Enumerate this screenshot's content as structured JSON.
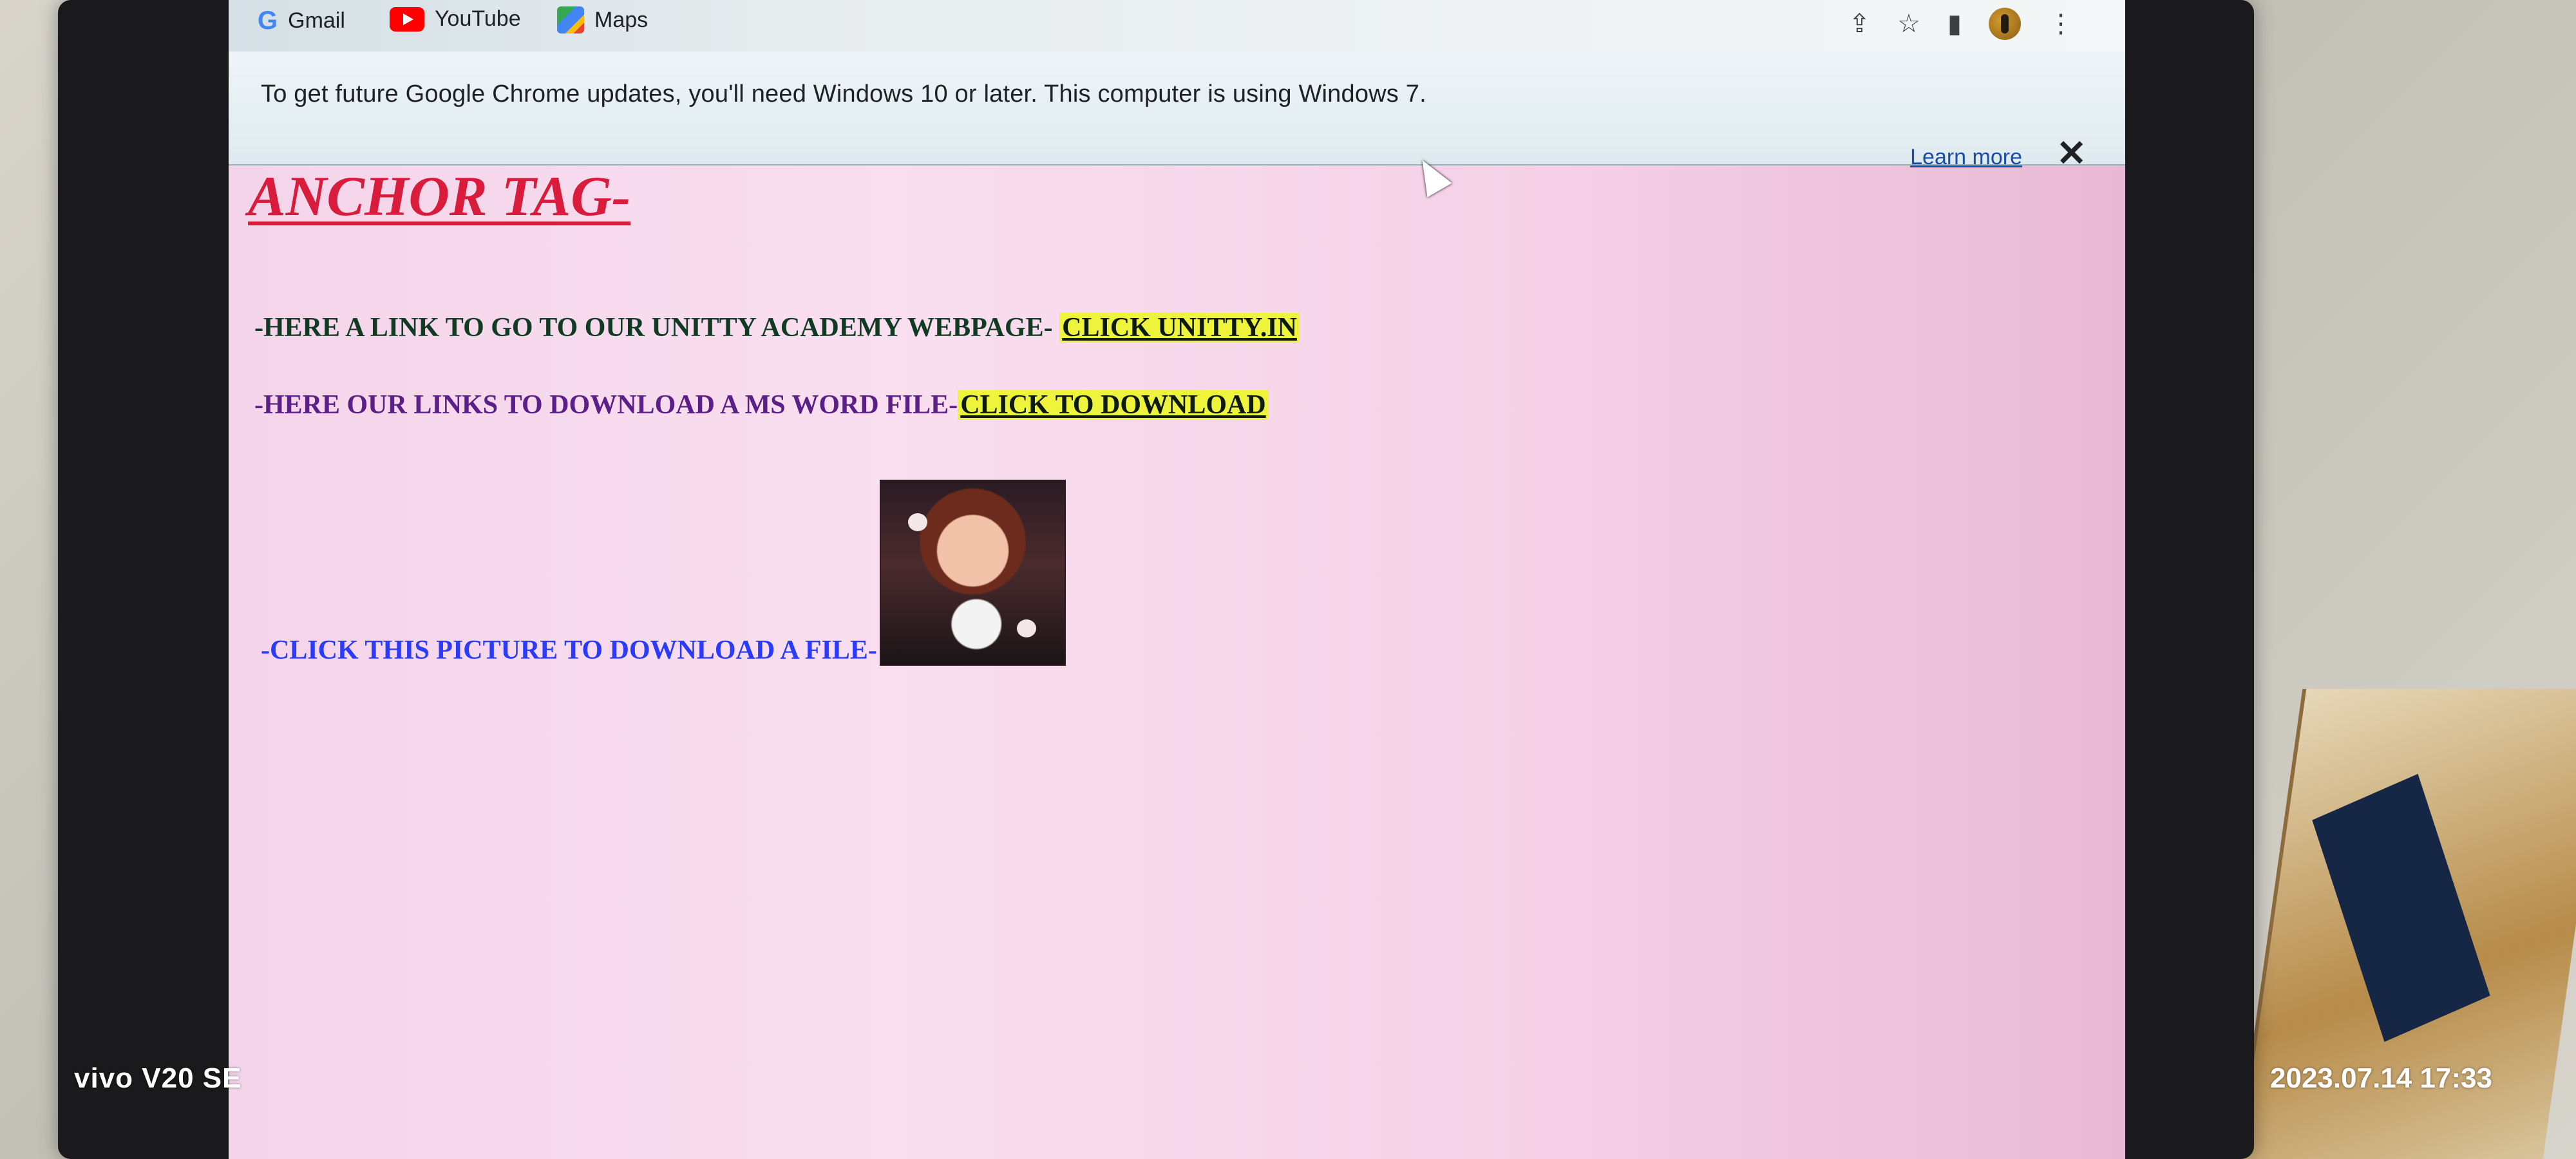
{
  "bookmarks": [
    {
      "label": "Gmail"
    },
    {
      "label": "YouTube"
    },
    {
      "label": "Maps"
    }
  ],
  "infobar": {
    "message": "To get future Google Chrome updates, you'll need Windows 10 or later. This computer is using Windows 7.",
    "learn_more": "Learn more",
    "close": "✕"
  },
  "page": {
    "title": "ANCHOR TAG-",
    "row1_text": "-HERE A LINK TO GO TO OUR UNITTY ACADEMY WEBPAGE- ",
    "row1_link": "CLICK UNITTY.IN",
    "row2_text": "-HERE OUR LINKS TO DOWNLOAD A MS WORD FILE-",
    "row2_link": "CLICK TO DOWNLOAD",
    "row3_text": "-CLICK THIS PICTURE TO DOWNLOAD A FILE-"
  },
  "photo_overlay": {
    "device": "vivo V20 SE",
    "timestamp": "2023.07.14 17:33"
  }
}
